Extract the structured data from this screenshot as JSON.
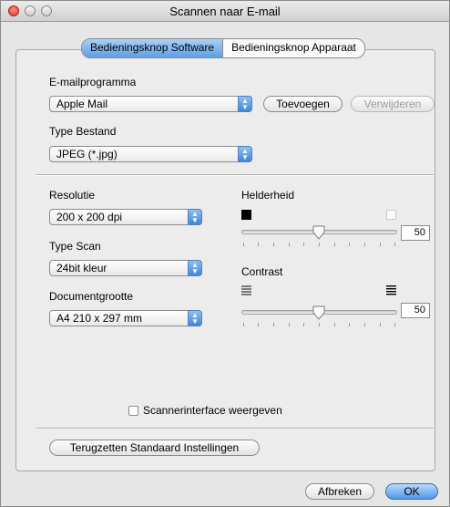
{
  "window": {
    "title": "Scannen naar E-mail"
  },
  "tabs": [
    {
      "label": "Bedieningsknop Software",
      "active": true
    },
    {
      "label": "Bedieningsknop Apparaat",
      "active": false
    }
  ],
  "email": {
    "label": "E-mailprogramma",
    "selected": "Apple Mail",
    "add_label": "Toevoegen",
    "remove_label": "Verwijderen"
  },
  "filetype": {
    "label": "Type Bestand",
    "selected": "JPEG (*.jpg)"
  },
  "resolution": {
    "label": "Resolutie",
    "selected": "200 x 200 dpi"
  },
  "scantype": {
    "label": "Type Scan",
    "selected": "24bit kleur"
  },
  "docsize": {
    "label": "Documentgrootte",
    "selected": "A4  210 x 297 mm"
  },
  "brightness": {
    "label": "Helderheid",
    "value": "50"
  },
  "contrast": {
    "label": "Contrast",
    "value": "50"
  },
  "scanner_interface": {
    "label": "Scannerinterface weergeven",
    "checked": false
  },
  "buttons": {
    "reset": "Terugzetten Standaard Instellingen",
    "cancel": "Afbreken",
    "ok": "OK"
  },
  "colors": {
    "accent": "#5d9ee4",
    "window_bg": "#e6e6e6"
  }
}
